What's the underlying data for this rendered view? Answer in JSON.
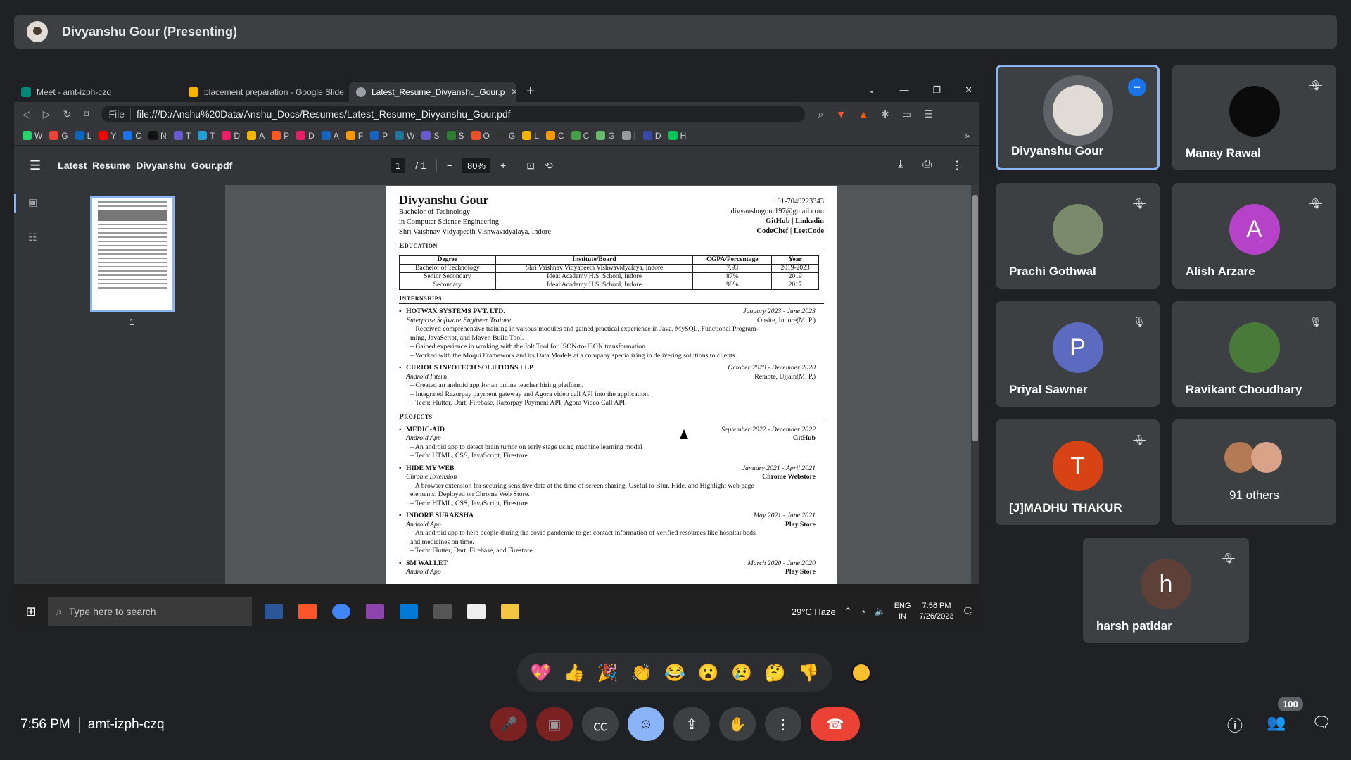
{
  "banner": {
    "presenter": "Divyanshu Gour (Presenting)"
  },
  "browser": {
    "tabs": [
      {
        "label": "Meet - amt-izph-czq"
      },
      {
        "label": "placement preparation - Google Slide"
      },
      {
        "label": "Latest_Resume_Divyanshu_Gour.p"
      }
    ],
    "url_scheme": "File",
    "url": "file:///D:/Anshu%20Data/Anshu_Docs/Resumes/Latest_Resume_Divyanshu_Gour.pdf",
    "bookmarks": [
      "W",
      "G",
      "L",
      "Y",
      "C",
      "N",
      "T",
      "T",
      "D",
      "A",
      "P",
      "D",
      "A",
      "F",
      "P",
      "W",
      "S",
      "S",
      "O",
      "G",
      "L",
      "C",
      "C",
      "G",
      "I",
      "D",
      "H"
    ]
  },
  "pdf": {
    "filename": "Latest_Resume_Divyanshu_Gour.pdf",
    "page_current": "1",
    "page_total": "/ 1",
    "zoom": "80%",
    "thumb_label": "1"
  },
  "resume": {
    "name": "Divyanshu Gour",
    "degree1": "Bachelor of Technology",
    "degree2": "in Computer Science Engineering",
    "college": "Shri Vaishnav Vidyapeeth Vishwavidyalaya, Indore",
    "phone": "+91-7049223343",
    "email": "divyanshugour197@gmail.com",
    "links1": "GitHub | Linkedin",
    "links2": "CodeChef | LeetCode",
    "sec_education": "Education",
    "edu_headers": [
      "Degree",
      "Institute/Board",
      "CGPA/Percentage",
      "Year"
    ],
    "edu_rows": [
      [
        "Bachelor of Technology",
        "Shri Vaishnav Vidyapeeth Vishwavidyalaya, Indore",
        "7.93",
        "2019-2023"
      ],
      [
        "Senior Secondary",
        "Ideal Academy H.S. School, Indore",
        "87%",
        "2019"
      ],
      [
        "Secondary",
        "Ideal Academy H.S. School, Indore",
        "90%",
        "2017"
      ]
    ],
    "sec_internships": "Internships",
    "sec_projects": "Projects",
    "entries": [
      {
        "title": "HOTWAX SYSTEMS PVT. LTD.",
        "date": "January 2023 - June 2023",
        "sub": "Enterprise Software Engineer Trainee",
        "loc": "Onsite, Indore(M. P.)",
        "bullets": [
          "– Received comprehensive training in various modules and gained practical experience in Java, MySQL, Functional Program-",
          "ming, JavaScript, and Maven Build Tool.",
          "– Gained experience in working with the Jolt Tool for JSON-to-JSON transformation.",
          "– Worked with the Moqui Framework and its Data Models at a company specializing in delivering solutions to clients."
        ]
      },
      {
        "title": "CURIOUS INFOTECH SOLUTIONS LLP",
        "date": "October 2020 - December 2020",
        "sub": "Android Intern",
        "loc": "Remote, Ujjain(M. P.)",
        "bullets": [
          "– Created an android app for an online teacher hiring platform.",
          "– Integrated Razorpay payment gateway and Agora video call API into the application.",
          "– Tech: Flutter, Dart, Firebase, Razorpay Payment API, Agora Video Call API."
        ]
      },
      {
        "title": "MEDIC-AID",
        "date": "September 2022 - December 2022",
        "sub": "Android App",
        "loc": "GitHub",
        "bullets": [
          "– An android app to detect brain tumor on early stage using machine learning model",
          "– Tech: HTML, CSS, JavaScript, Firestore"
        ]
      },
      {
        "title": "HIDE MY WEB",
        "date": "January 2021 - April 2021",
        "sub": "Chrome Extension",
        "loc": "Chrome Webstore",
        "bullets": [
          "– A browser extension for securing sensitive data at the time of screen sharing. Useful to Blur, Hide, and Highlight web page",
          "elements. Deployed on Chrome Web Store.",
          "– Tech: HTML, CSS, JavaScript, Firestore"
        ]
      },
      {
        "title": "INDORE SURAKSHA",
        "date": "May 2021 - June 2021",
        "sub": "Android App",
        "loc": "Play Store",
        "bullets": [
          "– An android app to help people during the covid pandemic to get contact information of verified resources like hospital beds",
          "and medicines on time.",
          "– Tech: Flutter, Dart, Firebase, and Firestore"
        ]
      },
      {
        "title": "SM WALLET",
        "date": "March 2020 - June 2020",
        "sub": "Android App",
        "loc": "Play Store",
        "bullets": []
      }
    ]
  },
  "taskbar": {
    "search_placeholder": "Type here to search",
    "weather": "29°C  Haze",
    "lang1": "ENG",
    "lang2": "IN",
    "time": "7:56 PM",
    "date": "7/26/2023"
  },
  "participants": [
    {
      "name": "Divyanshu Gour",
      "initial": "",
      "color": "#5f6368"
    },
    {
      "name": "Manay Rawal",
      "initial": "",
      "color": "#0b0b0b"
    },
    {
      "name": "Prachi Gothwal",
      "initial": "",
      "color": "#7a8a6a"
    },
    {
      "name": "Alish Arzare",
      "initial": "A",
      "color": "#b642c9"
    },
    {
      "name": "Priyal Sawner",
      "initial": "P",
      "color": "#5c6bc0"
    },
    {
      "name": "Ravikant Choudhary",
      "initial": "",
      "color": "#4a7a3a"
    },
    {
      "name": "[J]MADHU THAKUR",
      "initial": "T",
      "color": "#d84315"
    },
    {
      "name": "harsh patidar",
      "initial": "h",
      "color": "#5d4037"
    }
  ],
  "others_label": "91 others",
  "reactions": [
    "💖",
    "👍",
    "🎉",
    "👏",
    "😂",
    "😮",
    "😢",
    "🤔",
    "👎"
  ],
  "meeting": {
    "time": "7:56 PM",
    "code": "amt-izph-czq",
    "people_count": "100"
  },
  "colors": {
    "bg": "#202124",
    "tile": "#3c4043",
    "accent": "#8ab4f8",
    "end_call": "#ea4335",
    "muted": "#c5221f"
  }
}
